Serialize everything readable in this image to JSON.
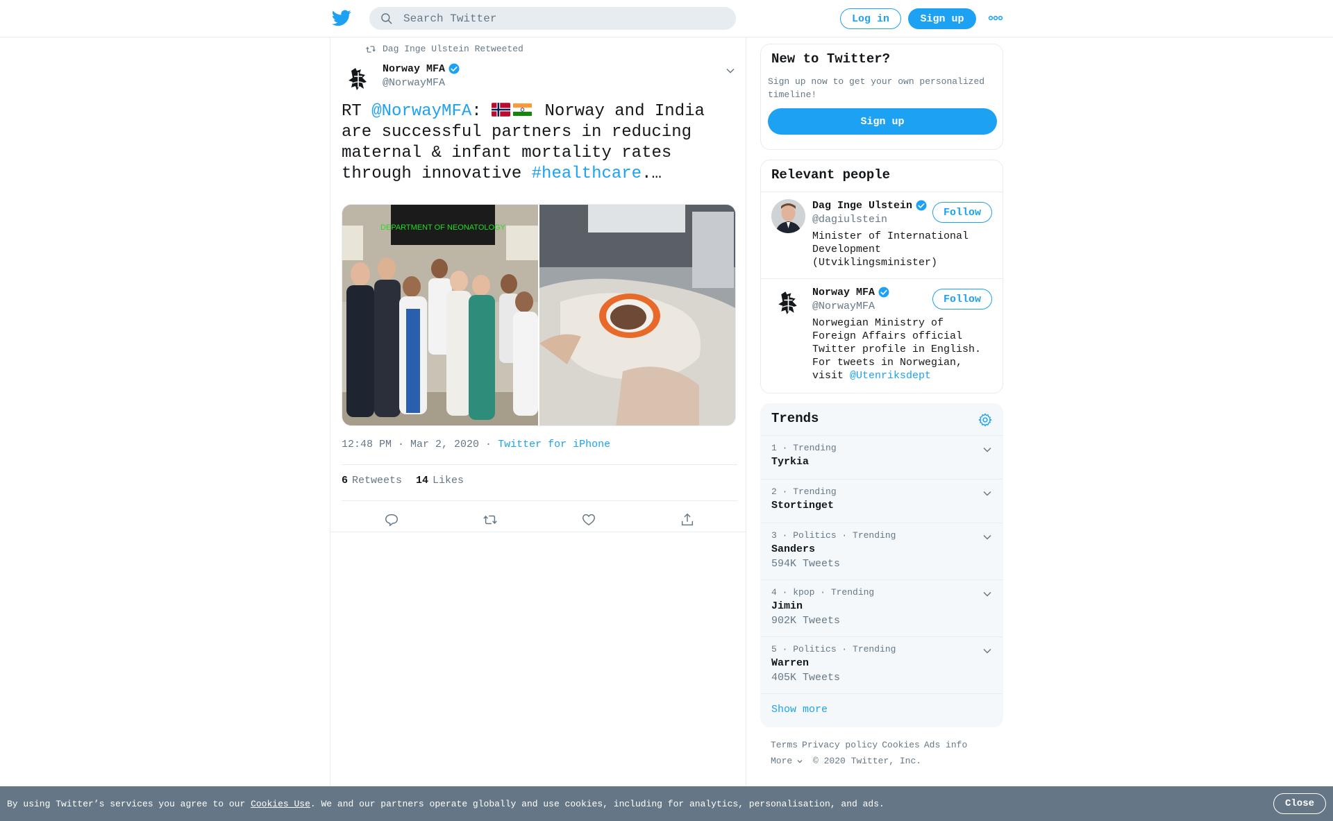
{
  "header": {
    "search_placeholder": "Search Twitter",
    "login_label": "Log in",
    "signup_label": "Sign up"
  },
  "tweet": {
    "retweeted_by": "Dag Inge Ulstein Retweeted",
    "author_name": "Norway MFA",
    "author_handle": "@NorwayMFA",
    "text_prefix": "RT ",
    "text_mention": "@NorwayMFA",
    "text_colon": ": ",
    "text_body": " Norway and India are successful partners in reducing maternal & infant mortality rates through innovative ",
    "text_hashtag": "#healthcare",
    "text_suffix": ".…",
    "timestamp": "12:48 PM · Mar 2, 2020",
    "separator": " · ",
    "client": "Twitter for iPhone",
    "retweets_count": "6",
    "retweets_label": "Retweets",
    "likes_count": "14",
    "likes_label": "Likes",
    "photo1_sign": "DEPARTMENT OF NEONATOLOGY"
  },
  "sidebar": {
    "new_to": {
      "title": "New to Twitter?",
      "subtitle": "Sign up now to get your own personalized timeline!",
      "button": "Sign up"
    },
    "relevant": {
      "title": "Relevant people",
      "people": [
        {
          "name": "Dag Inge Ulstein",
          "handle": "@dagiulstein",
          "bio": "Minister of International Development (Utviklingsminister)",
          "follow": "Follow"
        },
        {
          "name": "Norway MFA",
          "handle": "@NorwayMFA",
          "bio": "Norwegian Ministry of Foreign Affairs official Twitter profile in English. For tweets in Norwegian, visit ",
          "bio_link": "@Utenriksdept",
          "follow": "Follow"
        }
      ]
    },
    "trends": {
      "title": "Trends",
      "items": [
        {
          "meta": "1 · Trending",
          "name": "Tyrkia",
          "count": ""
        },
        {
          "meta": "2 · Trending",
          "name": "Stortinget",
          "count": ""
        },
        {
          "meta": "3 · Politics · Trending",
          "name": "Sanders",
          "count": "594K Tweets"
        },
        {
          "meta": "4 · kpop · Trending",
          "name": "Jimin",
          "count": "902K Tweets"
        },
        {
          "meta": "5 · Politics · Trending",
          "name": "Warren",
          "count": "405K Tweets"
        }
      ],
      "show_more": "Show more"
    },
    "footer": {
      "terms": "Terms",
      "privacy": "Privacy policy",
      "cookies": "Cookies",
      "ads": "Ads info",
      "more": "More",
      "copyright": "© 2020 Twitter, Inc."
    }
  },
  "cookie_bar": {
    "text_before": "By using Twitter’s services you agree to our ",
    "link": "Cookies Use",
    "text_after": ". We and our partners operate globally and use cookies, including for analytics, personalisation, and ads.",
    "close": "Close"
  },
  "colors": {
    "accent": "#1da1f2",
    "secondary_text": "#657786",
    "border": "#e6ecf0",
    "cookie_bg": "#657786"
  }
}
